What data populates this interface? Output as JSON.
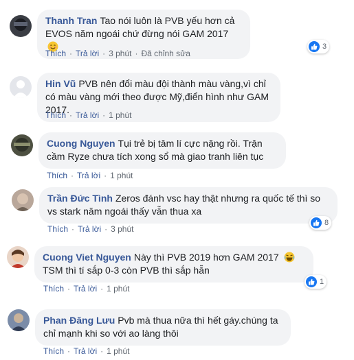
{
  "colors": {
    "author": "#385898",
    "bubble": "#f2f3f5",
    "like": "#1877f2",
    "meta": "#606770"
  },
  "actions": {
    "like": "Thích",
    "reply": "Trả lời",
    "edited": "Đã chỉnh sửa"
  },
  "comments": [
    {
      "author": "Thanh Tran",
      "text": "Tao nói luôn là PVB yếu hơn cả EVOS năm ngoái chứ đừng nói GAM 2017",
      "emoji": "smiling-face-icon",
      "time": "3 phút",
      "edited": true,
      "reactions": "3"
    },
    {
      "author": "Hin Vũ",
      "text": "PVB nên đổi màu đội thành màu vàng,vì chỉ có màu vàng mới theo được Mỹ,điển hình như GAM 2017.",
      "time": "1 phút"
    },
    {
      "author": "Cuong Nguyen",
      "text": "Tụi trẻ bị tâm lí cực nặng rồi. Trận cầm Ryze chưa tích xong sổ mà giao tranh liên tục",
      "time": "1 phút"
    },
    {
      "author": "Trần Đức Tình",
      "text": "Zeros đánh vsc hay thật nhưng ra quốc tế thì so vs stark năm ngoái thấy vẫn thua xa",
      "time": "3 phút",
      "reactions": "8"
    },
    {
      "author": "Cuong Viet Nguyen",
      "text": "Này thì PVB 2019 hơn GAM 2017",
      "text2": "TSM thì tí sắp 0-3 còn PVB thì sắp hẵn",
      "emoji": "laughing-face-icon",
      "time": "1 phút",
      "reactions": "1"
    },
    {
      "author": "Phan Đăng Lưu",
      "text": "Pvb mà thua nữa thì hết gáy.chúng ta chỉ mạnh khi so với ao làng thôi",
      "time": "1 phút"
    }
  ]
}
